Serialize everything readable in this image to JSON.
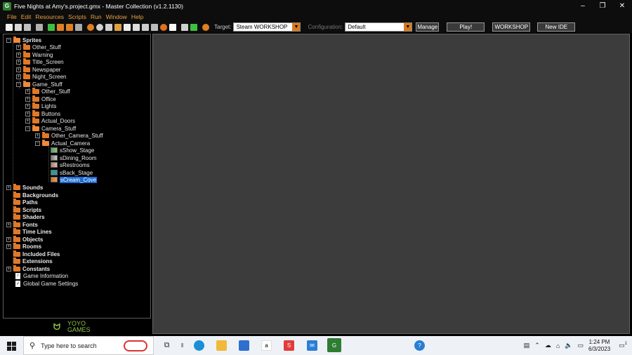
{
  "window": {
    "title": "Five Nights at Amy's.project.gmx  -  Master Collection (v1.2.1130)",
    "app_icon": "gamemaker-icon",
    "controls": [
      "–",
      "❐",
      "✕"
    ]
  },
  "menu": [
    "File",
    "Edit",
    "Resources",
    "Scripts",
    "Run",
    "Window",
    "Help"
  ],
  "toolbar": {
    "target_label": "Target:",
    "target_value": "Steam WORKSHOP",
    "configuration_label": "Configuration:",
    "configuration_value": "Default",
    "manage_label": "Manage",
    "play_label": "Play!",
    "workshop_label": "WORKSHOP",
    "new_ide_label": "New IDE"
  },
  "tree": {
    "sprites": "Sprites",
    "sprite_folders": [
      "Other_Stuff",
      "Warning",
      "Title_Screen",
      "Newspaper",
      "Night_Screen"
    ],
    "game_stuff": "Game_Stuff",
    "game_folders": [
      "Other_Stuff",
      "Office",
      "Lights",
      "Buttons",
      "Actual_Doors"
    ],
    "camera_stuff": "Camera_Stuff",
    "other_camera_stuff": "Other_Camera_Stuff",
    "actual_camera": "Actual_Camera",
    "camera_sprites": [
      "sShow_Stage",
      "sDining_Room",
      "sRestrooms",
      "sBack_Stage",
      "sCream_Cove"
    ],
    "selected_sprite": "sCream_Cove",
    "resources": [
      "Sounds",
      "Backgrounds",
      "Paths",
      "Scripts",
      "Shaders",
      "Fonts",
      "Time Lines",
      "Objects",
      "Rooms",
      "Included Files",
      "Extensions",
      "Constants"
    ],
    "game_information": "Game Information",
    "global_game_settings": "Global Game Settings"
  },
  "logo": {
    "text_top": "YOYO",
    "text_bottom": "GAMES"
  },
  "taskbar": {
    "search_placeholder": "Type here to search",
    "time": "1:24 PM",
    "date": "6/3/2023",
    "notification_count": "1"
  },
  "colors": {
    "accent_orange": "#e8a040",
    "folder_orange": "#e0782a",
    "selection_blue": "#1c6bd6",
    "workspace_gray": "#3c3c3c"
  }
}
